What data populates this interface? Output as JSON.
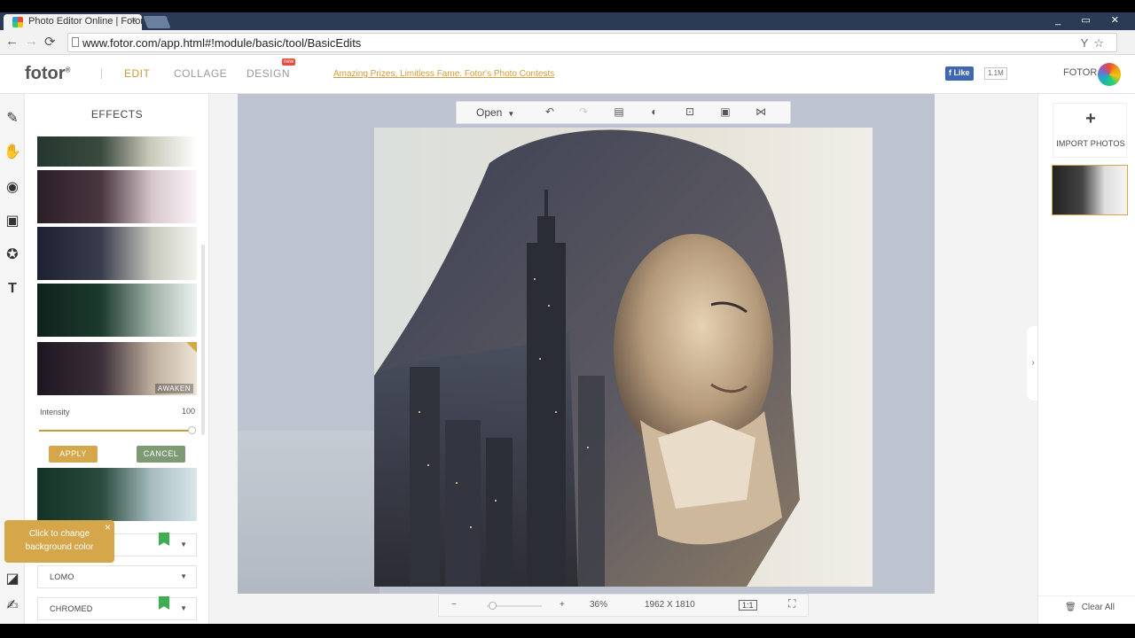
{
  "browser": {
    "tab_title": "Photo Editor Online | Fotor",
    "tab_close": "×",
    "url": "www.fotor.com/app.html#!module/basic/tool/BasicEdits",
    "window_controls": "_ ▭ ✕"
  },
  "header": {
    "logo": "fotor",
    "nav": [
      {
        "label": "EDIT",
        "active": true
      },
      {
        "label": "COLLAGE",
        "active": false
      },
      {
        "label": "DESIGN",
        "active": false
      }
    ],
    "new_badge": "new",
    "promo": "Amazing Prizes, Limitless Fame. Fotor's Photo Contests",
    "fb_like": "Like",
    "fb_count": "1.1M",
    "account": "FOTOR"
  },
  "left_panel": {
    "title": "EFFECTS",
    "selected_effect": "AWAKEN",
    "intensity_label": "Intensity",
    "intensity_value": "100",
    "intensity_fraction": 1.0,
    "apply": "APPLY",
    "cancel": "CANCEL",
    "categories": [
      "LOMO",
      "CHROMED"
    ],
    "tooltip": "Click to change background color",
    "tooltip_close": "×"
  },
  "canvas": {
    "open_label": "Open",
    "zoom_minus": "−",
    "zoom_plus": "+",
    "zoom_percent": "36%",
    "zoom_fraction": 0.1,
    "dimensions": "1962  X  1810",
    "ratio_btn": "1:1"
  },
  "right_panel": {
    "import_plus": "+",
    "import_label": "IMPORT PHOTOS",
    "clear_all": "Clear All"
  },
  "colors": {
    "accent": "#c79a3a",
    "apply": "#d6a64a",
    "cancel": "#7e9a74"
  }
}
